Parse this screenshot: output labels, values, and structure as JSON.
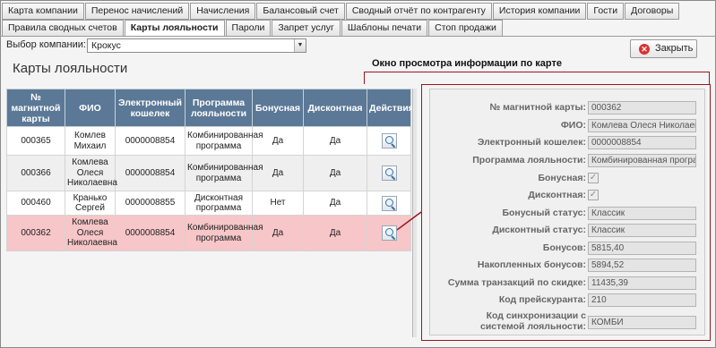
{
  "tabs_row1": [
    {
      "label": "Карта компании"
    },
    {
      "label": "Перенос начислений"
    },
    {
      "label": "Начисления"
    },
    {
      "label": "Балансовый счет"
    },
    {
      "label": "Сводный отчёт по контрагенту"
    },
    {
      "label": "История компании"
    },
    {
      "label": "Гости"
    },
    {
      "label": "Договоры"
    }
  ],
  "tabs_row2": [
    {
      "label": "Правила сводных счетов"
    },
    {
      "label": "Карты лояльности"
    },
    {
      "label": "Пароли"
    },
    {
      "label": "Запрет услуг"
    },
    {
      "label": "Шаблоны печати"
    },
    {
      "label": "Стоп продажи"
    }
  ],
  "active_tab": "Карты лояльности",
  "company": {
    "label": "Выбор компании:",
    "value": "Крокус"
  },
  "close_label": "Закрыть",
  "page_title": "Карты лояльности",
  "annotation": "Окно просмотра информации по карте",
  "table": {
    "headers": [
      "№ магнитной карты",
      "ФИО",
      "Электронный кошелек",
      "Программа лояльности",
      "Бонусная",
      "Дисконтная",
      "Действия"
    ],
    "rows": [
      {
        "card": "000365",
        "name": "Комлев Михаил",
        "wallet": "0000008854",
        "program": "Комбинированная программа",
        "bonus": "Да",
        "discount": "Да"
      },
      {
        "card": "000366",
        "name": "Комлева Олеся Николаевна",
        "wallet": "0000008854",
        "program": "Комбинированная программа",
        "bonus": "Да",
        "discount": "Да"
      },
      {
        "card": "000460",
        "name": "Кранько Сергей",
        "wallet": "0000008855",
        "program": "Дисконтная программа",
        "bonus": "Нет",
        "discount": "Да"
      },
      {
        "card": "000362",
        "name": "Комлева Олеся Николаевна",
        "wallet": "0000008854",
        "program": "Комбинированная программа",
        "bonus": "Да",
        "discount": "Да"
      }
    ]
  },
  "details": {
    "card_label": "№ магнитной карты:",
    "card": "000362",
    "name_label": "ФИО:",
    "name": "Комлева Олеся Николаевн",
    "wallet_label": "Электронный кошелек:",
    "wallet": "0000008854",
    "program_label": "Программа лояльности:",
    "program": "Комбинированная програм",
    "bonus_label": "Бонусная:",
    "bonus_checked": true,
    "discount_label": "Дисконтная:",
    "discount_checked": true,
    "bonus_status_label": "Бонусный статус:",
    "bonus_status": "Классик",
    "discount_status_label": "Дисконтный статус:",
    "discount_status": "Классик",
    "bonuses_label": "Бонусов:",
    "bonuses": "5815,40",
    "accum_label": "Накопленных бонусов:",
    "accum": "5894,52",
    "sum_label": "Сумма транзакций по скидке:",
    "sum": "11435,39",
    "price_code_label": "Код прейскуранта:",
    "price_code": "210",
    "sync_label_1": "Код синхронизации с",
    "sync_label_2": "системой лояльности:",
    "sync": "КОМБИ"
  },
  "colors": {
    "header_bg": "#5b7896",
    "selected_row": "#f7c6c8",
    "annotation": "#9b1520"
  }
}
